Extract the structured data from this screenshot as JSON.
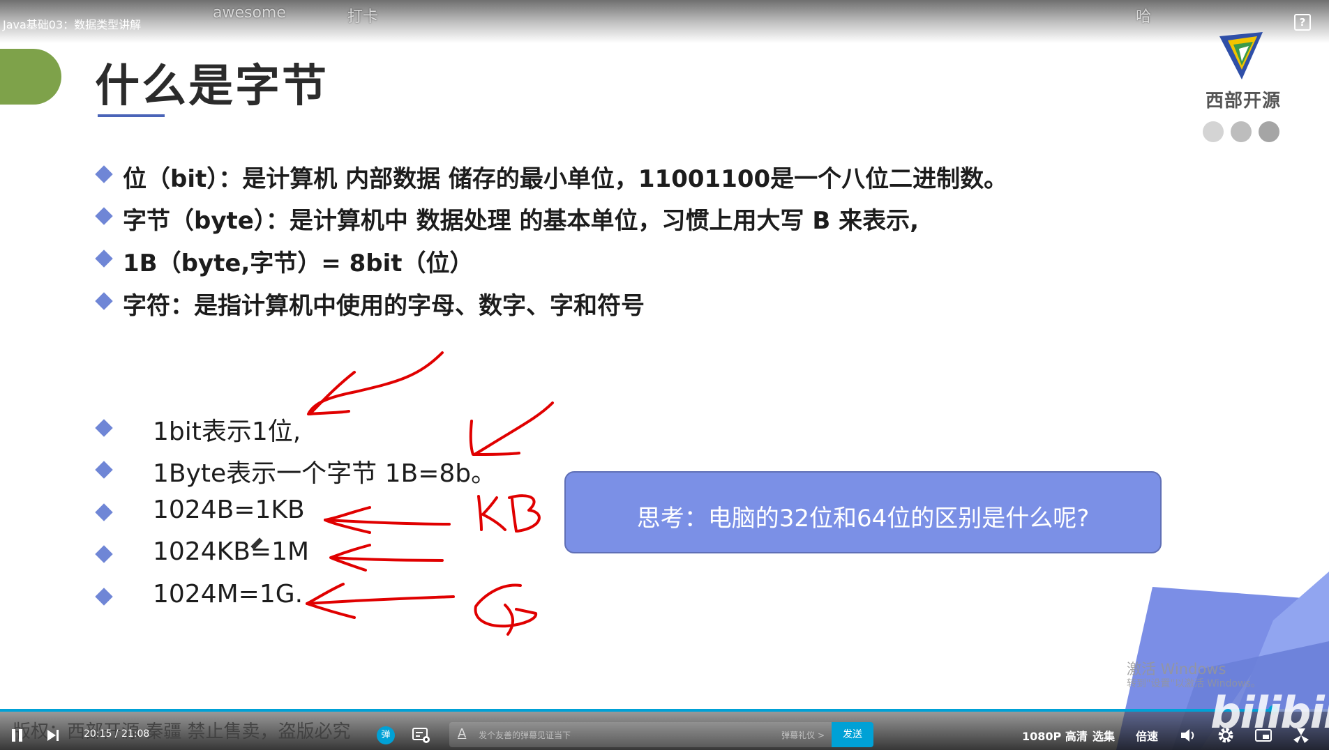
{
  "video": {
    "title": "Java基础03：数据类型讲解",
    "danmaku": [
      "awesome",
      "打卡",
      "哈"
    ]
  },
  "slide": {
    "title": "什么是字节",
    "bullets": [
      "位（bit）：是计算机 内部数据 储存的最小单位，11001100是一个八位二进制数。",
      "字节（byte）：是计算机中 数据处理 的基本单位，习惯上用大写 B 来表示,",
      "1B（byte,字节）= 8bit（位）",
      "字符：是指计算机中使用的字母、数字、字和符号"
    ],
    "units": [
      "1bit表示1位,",
      "1Byte表示一个字节 1B=8b。",
      "1024B=1KB",
      "1024KB=1M",
      "1024M=1G."
    ],
    "think_box": "思考：电脑的32位和64位的区别是什么呢?",
    "logo_text": "西部开源",
    "accent_colors": {
      "title_tab": "#7ea24a",
      "bullet": "#6f86d6",
      "think_box": "#7b90e6",
      "annotation": "#e00000"
    }
  },
  "system": {
    "activate_windows": "激活 Windows",
    "activate_windows_sub": "转到\"设置\"以激活 Windows。"
  },
  "player": {
    "watermark": "版权：西部开源 秦疆    禁止售卖，盗版必究",
    "current_time": "20:15",
    "total_time": "21:08",
    "time_display": "20:15 / 21:08",
    "progress_fraction": 0.958,
    "danmaku_toggle_label": "弹",
    "danmaku_placeholder": "发个友善的弹幕见证当下",
    "danmaku_etiquette": "弹幕礼仪 >",
    "send_label": "发送",
    "quality_label": "1080P 高清",
    "episodes_label": "选集",
    "speed_label": "倍速",
    "brand": "bilibili"
  }
}
